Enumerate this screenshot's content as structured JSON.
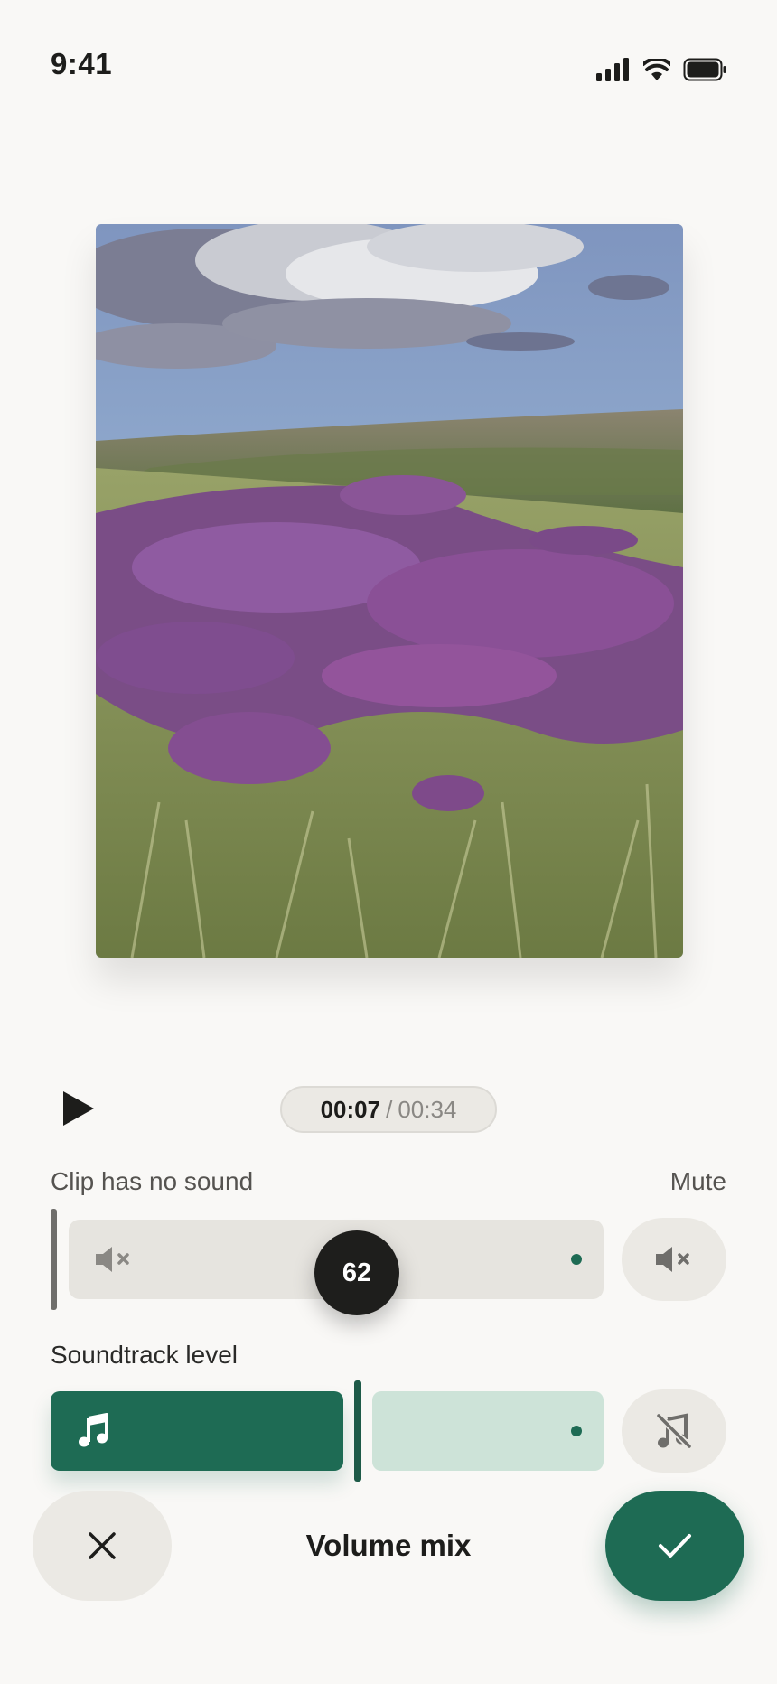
{
  "status_bar": {
    "time": "9:41",
    "icons": [
      "signal-icon",
      "wifi-icon",
      "battery-icon"
    ]
  },
  "preview": {
    "icon": "heather-moorland-photo"
  },
  "playback": {
    "play_icon": "play-icon",
    "current_time": "00:07",
    "separator": "/",
    "total_time": "00:34"
  },
  "clip": {
    "label": "Clip has no sound",
    "mute_label": "Mute",
    "icon": "speaker-muted-icon",
    "level": "62",
    "mute_button_icon": "speaker-muted-icon"
  },
  "soundtrack": {
    "label": "Soundtrack level",
    "icon": "music-note-icon",
    "level_fraction": 0.6,
    "mute_button_icon": "music-off-icon"
  },
  "bottom_bar": {
    "title": "Volume mix",
    "cancel_icon": "close-icon",
    "confirm_icon": "check-icon"
  },
  "colors": {
    "accent": "#1e6b54",
    "accent_light": "#cde3d8",
    "track_bg": "#e6e4df",
    "background": "#f9f8f6"
  }
}
